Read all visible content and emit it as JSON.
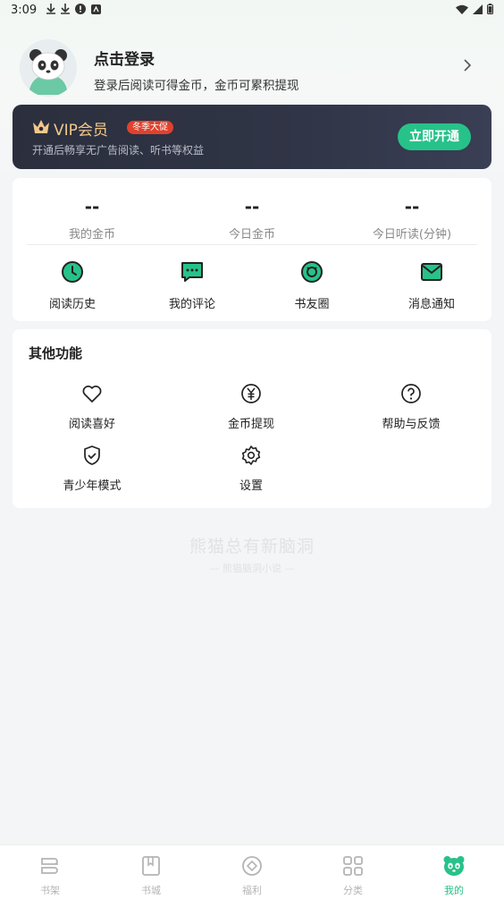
{
  "status_bar": {
    "time": "3:09"
  },
  "login": {
    "title": "点击登录",
    "subtitle": "登录后阅读可得金币，金币可累积提现"
  },
  "vip": {
    "title": "VIP会员",
    "badge": "冬季大促",
    "description": "开通后畅享无广告阅读、听书等权益",
    "button": "立即开通"
  },
  "stats": [
    {
      "value": "--",
      "label": "我的金币"
    },
    {
      "value": "--",
      "label": "今日金币"
    },
    {
      "value": "--",
      "label": "今日听读(分钟)"
    }
  ],
  "quick_actions": [
    {
      "label": "阅读历史",
      "icon": "clock-icon"
    },
    {
      "label": "我的评论",
      "icon": "comment-icon"
    },
    {
      "label": "书友圈",
      "icon": "circle-icon"
    },
    {
      "label": "消息通知",
      "icon": "mail-icon"
    }
  ],
  "other": {
    "title": "其他功能",
    "items": [
      {
        "label": "阅读喜好",
        "icon": "heart-icon"
      },
      {
        "label": "金币提现",
        "icon": "yuan-icon"
      },
      {
        "label": "帮助与反馈",
        "icon": "help-icon"
      },
      {
        "label": "青少年模式",
        "icon": "shield-icon"
      },
      {
        "label": "设置",
        "icon": "gear-icon"
      }
    ]
  },
  "slogan": {
    "main": "熊猫总有新脑洞",
    "sub": "— 熊猫脑洞小说 —"
  },
  "bottom_nav": [
    {
      "label": "书架",
      "active": false
    },
    {
      "label": "书城",
      "active": false
    },
    {
      "label": "福利",
      "active": false
    },
    {
      "label": "分类",
      "active": false
    },
    {
      "label": "我的",
      "active": true
    }
  ],
  "colors": {
    "accent": "#27c28a",
    "vip_gold": "#f3c88a",
    "badge_red": "#e0422d"
  }
}
